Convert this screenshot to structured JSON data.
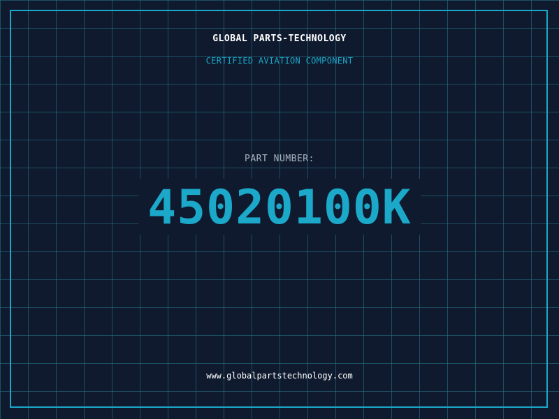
{
  "brand": {
    "name": "GLOBAL PARTS-TECHNOLOGY",
    "tagline": "CERTIFIED AVIATION COMPONENT"
  },
  "part": {
    "label": "PART NUMBER:",
    "number": "45020100K"
  },
  "footer": {
    "website": "www.globalpartstechnology.com"
  },
  "colors": {
    "background": "#0f1a2e",
    "accent": "#1ba8c9",
    "text_primary": "#ffffff",
    "text_muted": "#a9b4c2"
  }
}
